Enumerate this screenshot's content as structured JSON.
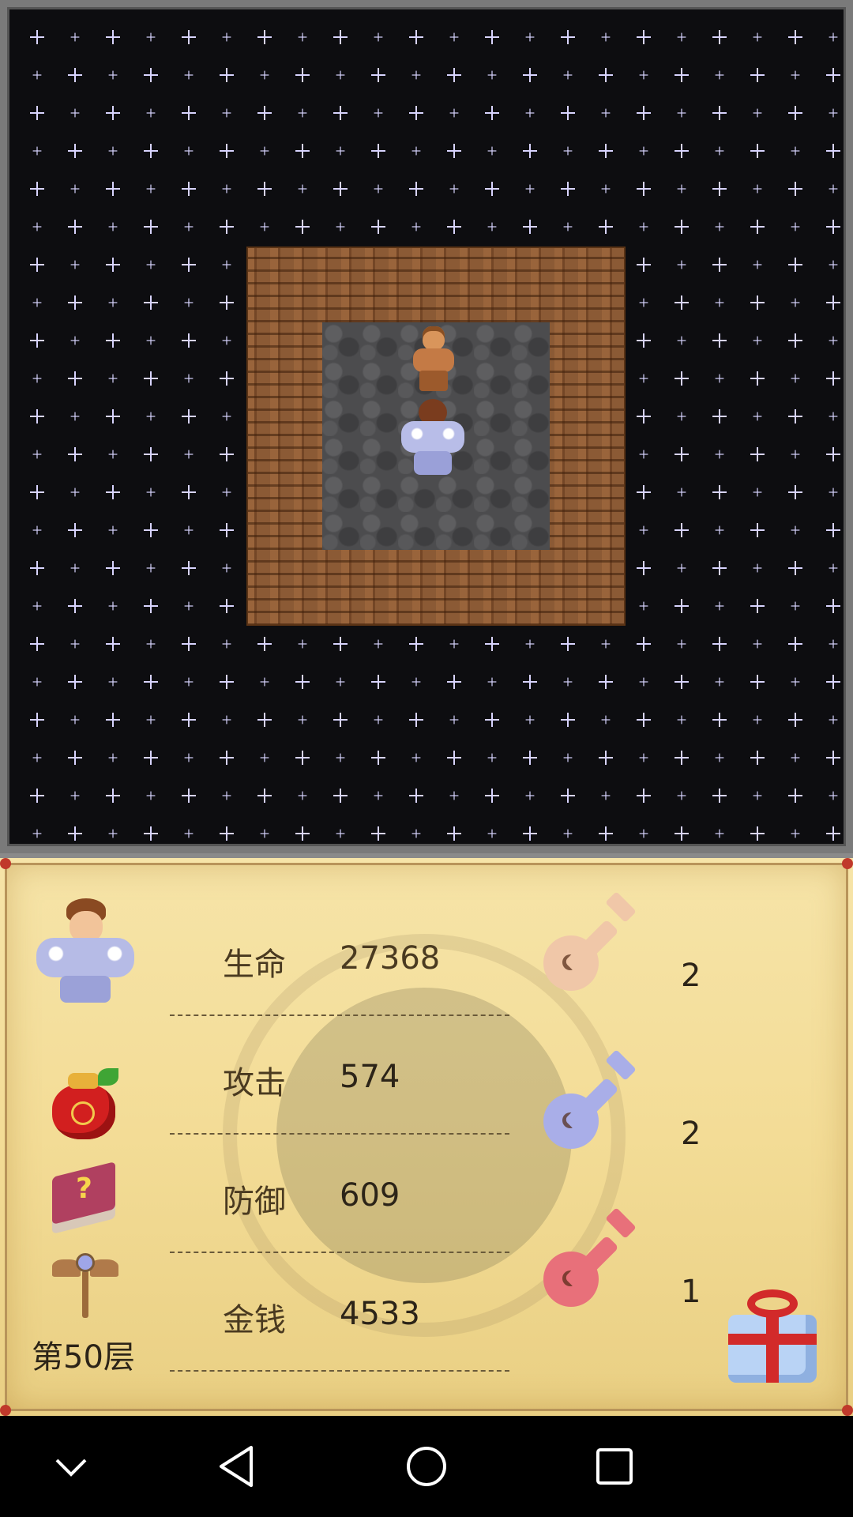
{
  "game": {
    "floor_label": "第50层"
  },
  "stats": [
    {
      "label": "生命",
      "value": "27368"
    },
    {
      "label": "攻击",
      "value": "574"
    },
    {
      "label": "防御",
      "value": "609"
    },
    {
      "label": "金钱",
      "value": "4533"
    }
  ],
  "keys": [
    {
      "name": "yellow-key-icon",
      "color": "#f0c7a8",
      "count": "2"
    },
    {
      "name": "blue-key-icon",
      "color": "#a9aee8",
      "count": "2"
    },
    {
      "name": "red-key-icon",
      "color": "#e8707a",
      "count": "1"
    }
  ],
  "colors": {
    "panel_bg": "#f3dc96",
    "map_bg": "#0d0d10",
    "wall": "#8b5a35",
    "floor": "#4c4c4e"
  },
  "navbar": {
    "icons": [
      "chevron-down-icon",
      "back-icon",
      "home-icon",
      "recents-icon"
    ]
  }
}
